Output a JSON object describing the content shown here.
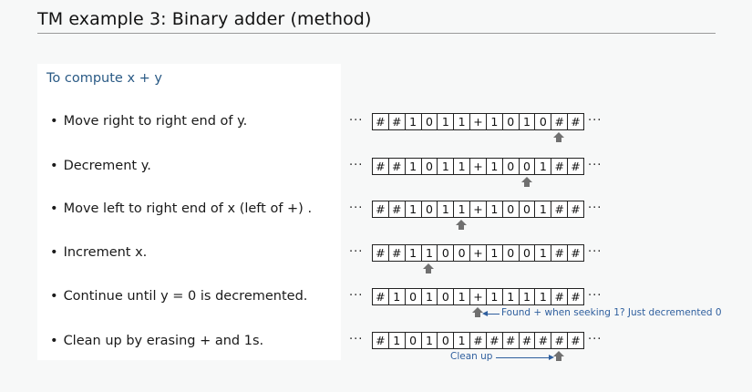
{
  "title": "TM example 3: Binary adder (method)",
  "subtitle": "To compute x + y",
  "bullet": "•",
  "ellipsis": "···",
  "steps": [
    {
      "text": "Move right to right end of y.",
      "tape": [
        "#",
        "#",
        "1",
        "0",
        "1",
        "1",
        "+",
        "1",
        "0",
        "1",
        "0",
        "#",
        "#"
      ],
      "head": 11
    },
    {
      "text": "Decrement y.",
      "tape": [
        "#",
        "#",
        "1",
        "0",
        "1",
        "1",
        "+",
        "1",
        "0",
        "0",
        "1",
        "#",
        "#"
      ],
      "head": 9
    },
    {
      "text": "Move left to right end of x (left of +) .",
      "tape": [
        "#",
        "#",
        "1",
        "0",
        "1",
        "1",
        "+",
        "1",
        "0",
        "0",
        "1",
        "#",
        "#"
      ],
      "head": 5
    },
    {
      "text": "Increment x.",
      "tape": [
        "#",
        "#",
        "1",
        "1",
        "0",
        "0",
        "+",
        "1",
        "0",
        "0",
        "1",
        "#",
        "#"
      ],
      "head": 3
    },
    {
      "text": "Continue until y = 0 is decremented.",
      "tape": [
        "#",
        "1",
        "0",
        "1",
        "0",
        "1",
        "+",
        "1",
        "1",
        "1",
        "1",
        "#",
        "#"
      ],
      "head": 6,
      "note": "Found + when seeking 1? Just decremented 0"
    },
    {
      "text": "Clean up by erasing + and 1s.",
      "tape": [
        "#",
        "1",
        "0",
        "1",
        "0",
        "1",
        "#",
        "#",
        "#",
        "#",
        "#",
        "#",
        "#"
      ],
      "head": 11,
      "note": "Clean up"
    }
  ],
  "colors": {
    "subtitle": "#2a5a85",
    "annotation": "#2f5f9e",
    "head": "#707070"
  }
}
